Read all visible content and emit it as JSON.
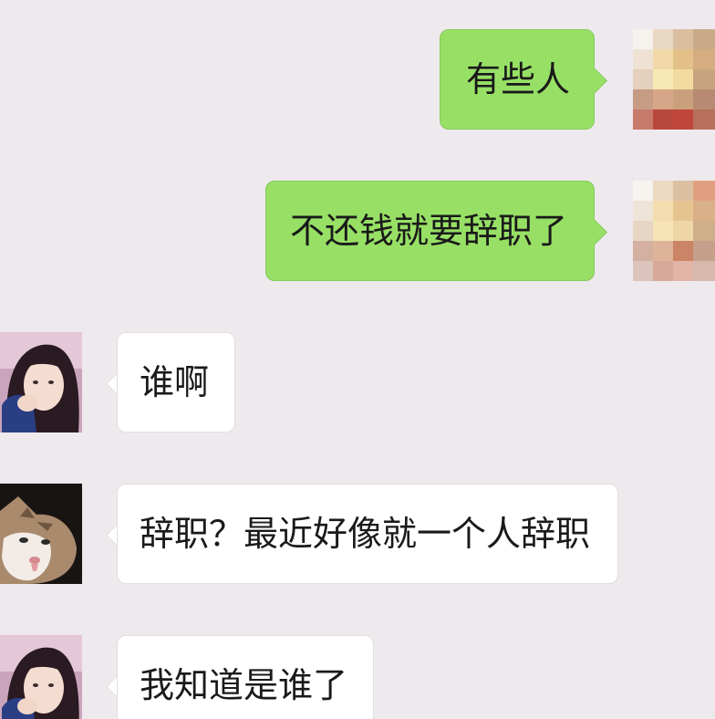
{
  "conversation": {
    "messages": [
      {
        "side": "sent",
        "text": "有些人",
        "avatar": "pixelated-avatar"
      },
      {
        "side": "sent",
        "text": "不还钱就要辞职了",
        "avatar": "pixelated-avatar"
      },
      {
        "side": "received",
        "text": "谁啊",
        "avatar": "girl-avatar"
      },
      {
        "side": "received",
        "text": "辞职？最近好像就一个人辞职",
        "avatar": "cat-avatar"
      },
      {
        "side": "received",
        "text": "我知道是谁了",
        "avatar": "girl-avatar"
      }
    ]
  },
  "colors": {
    "background": "#eee9ed",
    "sent_bubble": "#97e065",
    "received_bubble": "#ffffff"
  }
}
